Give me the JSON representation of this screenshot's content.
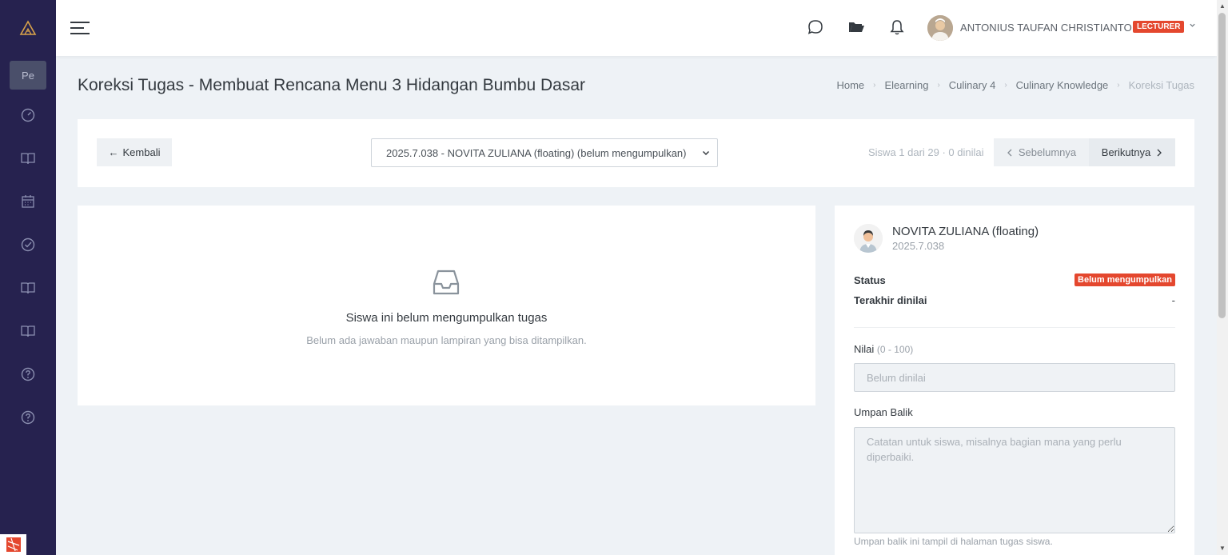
{
  "sidebar": {
    "logo_icon": "triangle-logo",
    "pe_label": "Pe",
    "items": [
      {
        "icon": "dashboard-gauge-icon"
      },
      {
        "icon": "book-icon"
      },
      {
        "icon": "calendar-icon"
      },
      {
        "icon": "check-circle-icon"
      },
      {
        "icon": "book-icon"
      },
      {
        "icon": "book-icon"
      },
      {
        "icon": "help-circle-icon"
      },
      {
        "icon": "help-circle-icon"
      }
    ]
  },
  "topbar": {
    "user_name": "ANTONIUS TAUFAN CHRISTIANTO",
    "role_badge": "LECTURER",
    "accent": "#e4472e"
  },
  "page": {
    "title": "Koreksi Tugas - Membuat Rencana Menu 3 Hidangan Bumbu Dasar",
    "breadcrumb": [
      "Home",
      "Elearning",
      "Culinary 4",
      "Culinary Knowledge",
      "Koreksi Tugas"
    ]
  },
  "toolbar": {
    "back_label": "Kembali",
    "selected_student": "2025.7.038 - NOVITA ZULIANA (floating) (belum mengumpulkan)",
    "counter": "Siswa 1 dari 29 · 0 dinilai",
    "prev_label": "Sebelumnya",
    "next_label": "Berikutnya"
  },
  "submission": {
    "empty_title": "Siswa ini belum mengumpulkan tugas",
    "empty_subtitle": "Belum ada jawaban maupun lampiran yang bisa ditampilkan."
  },
  "grading": {
    "student_name": "NOVITA ZULIANA (floating)",
    "student_id": "2025.7.038",
    "status_label": "Status",
    "status_value": "Belum mengumpulkan",
    "last_graded_label": "Terakhir dinilai",
    "last_graded_value": "-",
    "score_label": "Nilai",
    "score_hint": "(0 - 100)",
    "score_placeholder": "Belum dinilai",
    "feedback_label": "Umpan Balik",
    "feedback_placeholder": "Catatan untuk siswa, misalnya bagian mana yang perlu diperbaiki.",
    "feedback_help": "Umpan balik ini tampil di halaman tugas siswa."
  }
}
